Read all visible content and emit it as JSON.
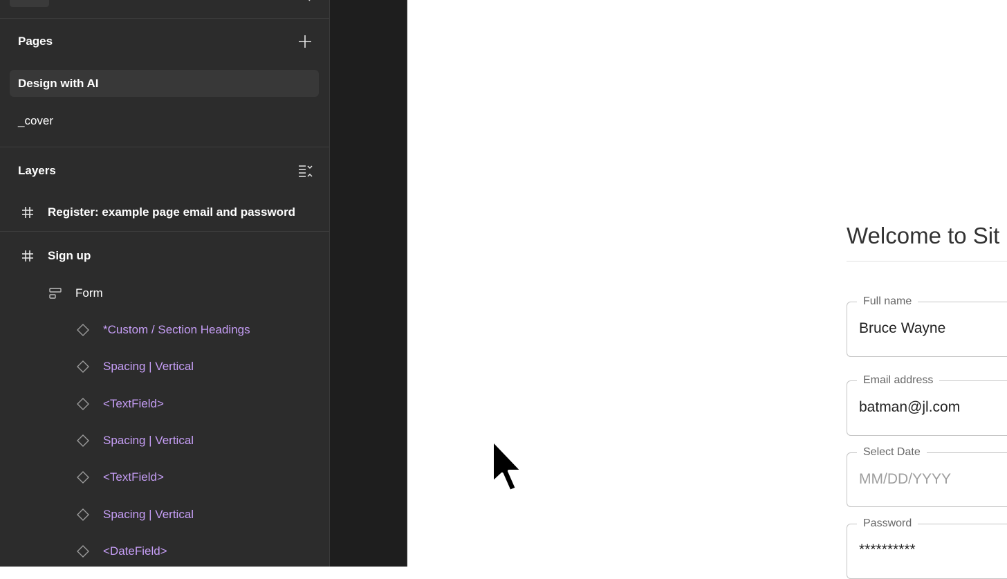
{
  "sidebar": {
    "pages": {
      "title": "Pages",
      "items": [
        {
          "label": "Design with AI",
          "active": true
        },
        {
          "label": "_cover",
          "active": false
        }
      ]
    },
    "layers": {
      "title": "Layers",
      "items": [
        {
          "label": "Register: example page email and password",
          "kind": "frame",
          "icon": "hash-icon"
        },
        {
          "label": "Sign up",
          "kind": "frame",
          "icon": "hash-icon"
        },
        {
          "label": "Form",
          "kind": "autolayout",
          "icon": "autolayout-icon"
        },
        {
          "label": "*Custom / Section Headings",
          "kind": "instance",
          "icon": "diamond-icon"
        },
        {
          "label": "Spacing | Vertical",
          "kind": "instance",
          "icon": "diamond-icon"
        },
        {
          "label": "<TextField>",
          "kind": "instance",
          "icon": "diamond-icon"
        },
        {
          "label": "Spacing | Vertical",
          "kind": "instance",
          "icon": "diamond-icon"
        },
        {
          "label": "<TextField>",
          "kind": "instance",
          "icon": "diamond-icon"
        },
        {
          "label": "Spacing | Vertical",
          "kind": "instance",
          "icon": "diamond-icon"
        },
        {
          "label": "<DateField>",
          "kind": "instance",
          "icon": "diamond-icon"
        }
      ]
    }
  },
  "canvas": {
    "form_title": "Welcome to Sit",
    "fields": [
      {
        "label": "Full name",
        "value": "Bruce Wayne",
        "placeholder": false
      },
      {
        "label": "Email address",
        "value": "batman@jl.com",
        "placeholder": false
      },
      {
        "label": "Select Date",
        "value": "MM/DD/YYYY",
        "placeholder": true
      },
      {
        "label": "Password",
        "value": "**********",
        "placeholder": false
      }
    ]
  },
  "colors": {
    "sidebar_bg": "#2c2c2c",
    "component_text": "#c69ef6",
    "canvas_dark": "#1e1e1e",
    "canvas_light": "#ffffff"
  }
}
